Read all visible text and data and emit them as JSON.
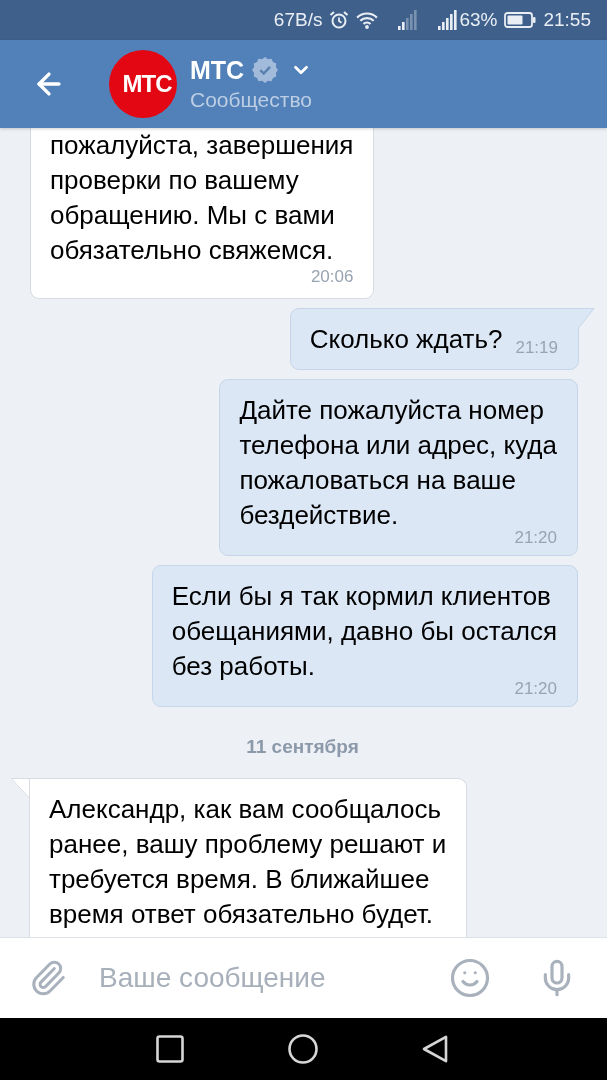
{
  "status_bar": {
    "network_speed": "67B/s",
    "battery_percent": "63%",
    "time": "21:55"
  },
  "header": {
    "logo_text": "МТС",
    "title": "МТС",
    "verified": true,
    "subtitle": "Сообщество"
  },
  "chat": [
    {
      "kind": "incoming",
      "tail": false,
      "lines": [
        "пожалуйста, завершения",
        "проверки по вашему",
        "обращению. Мы с вами",
        "обязательно свяжемся."
      ],
      "time": "20:06"
    },
    {
      "kind": "outgoing",
      "tail": true,
      "lines": [
        "Сколько ждать?"
      ],
      "time": "21:19"
    },
    {
      "kind": "outgoing",
      "tail": false,
      "lines": [
        "Дайте пожалуйста номер",
        "телефона или адрес, куда",
        "пожаловаться на ваше",
        "бездействие."
      ],
      "time": "21:20"
    },
    {
      "kind": "outgoing",
      "tail": false,
      "lines": [
        "Если бы я так кормил клиентов",
        "обещаниями, давно бы остался",
        "без работы."
      ],
      "time": "21:20"
    },
    {
      "kind": "date",
      "text": "11 сентября"
    },
    {
      "kind": "incoming",
      "tail": true,
      "lines": [
        "Александр, как вам сообщалось",
        "ранее, вашу проблему решают и",
        "требуется время. В ближайшее",
        "время ответ обязательно будет."
      ]
    }
  ],
  "composer": {
    "placeholder": "Ваше сообщение"
  }
}
